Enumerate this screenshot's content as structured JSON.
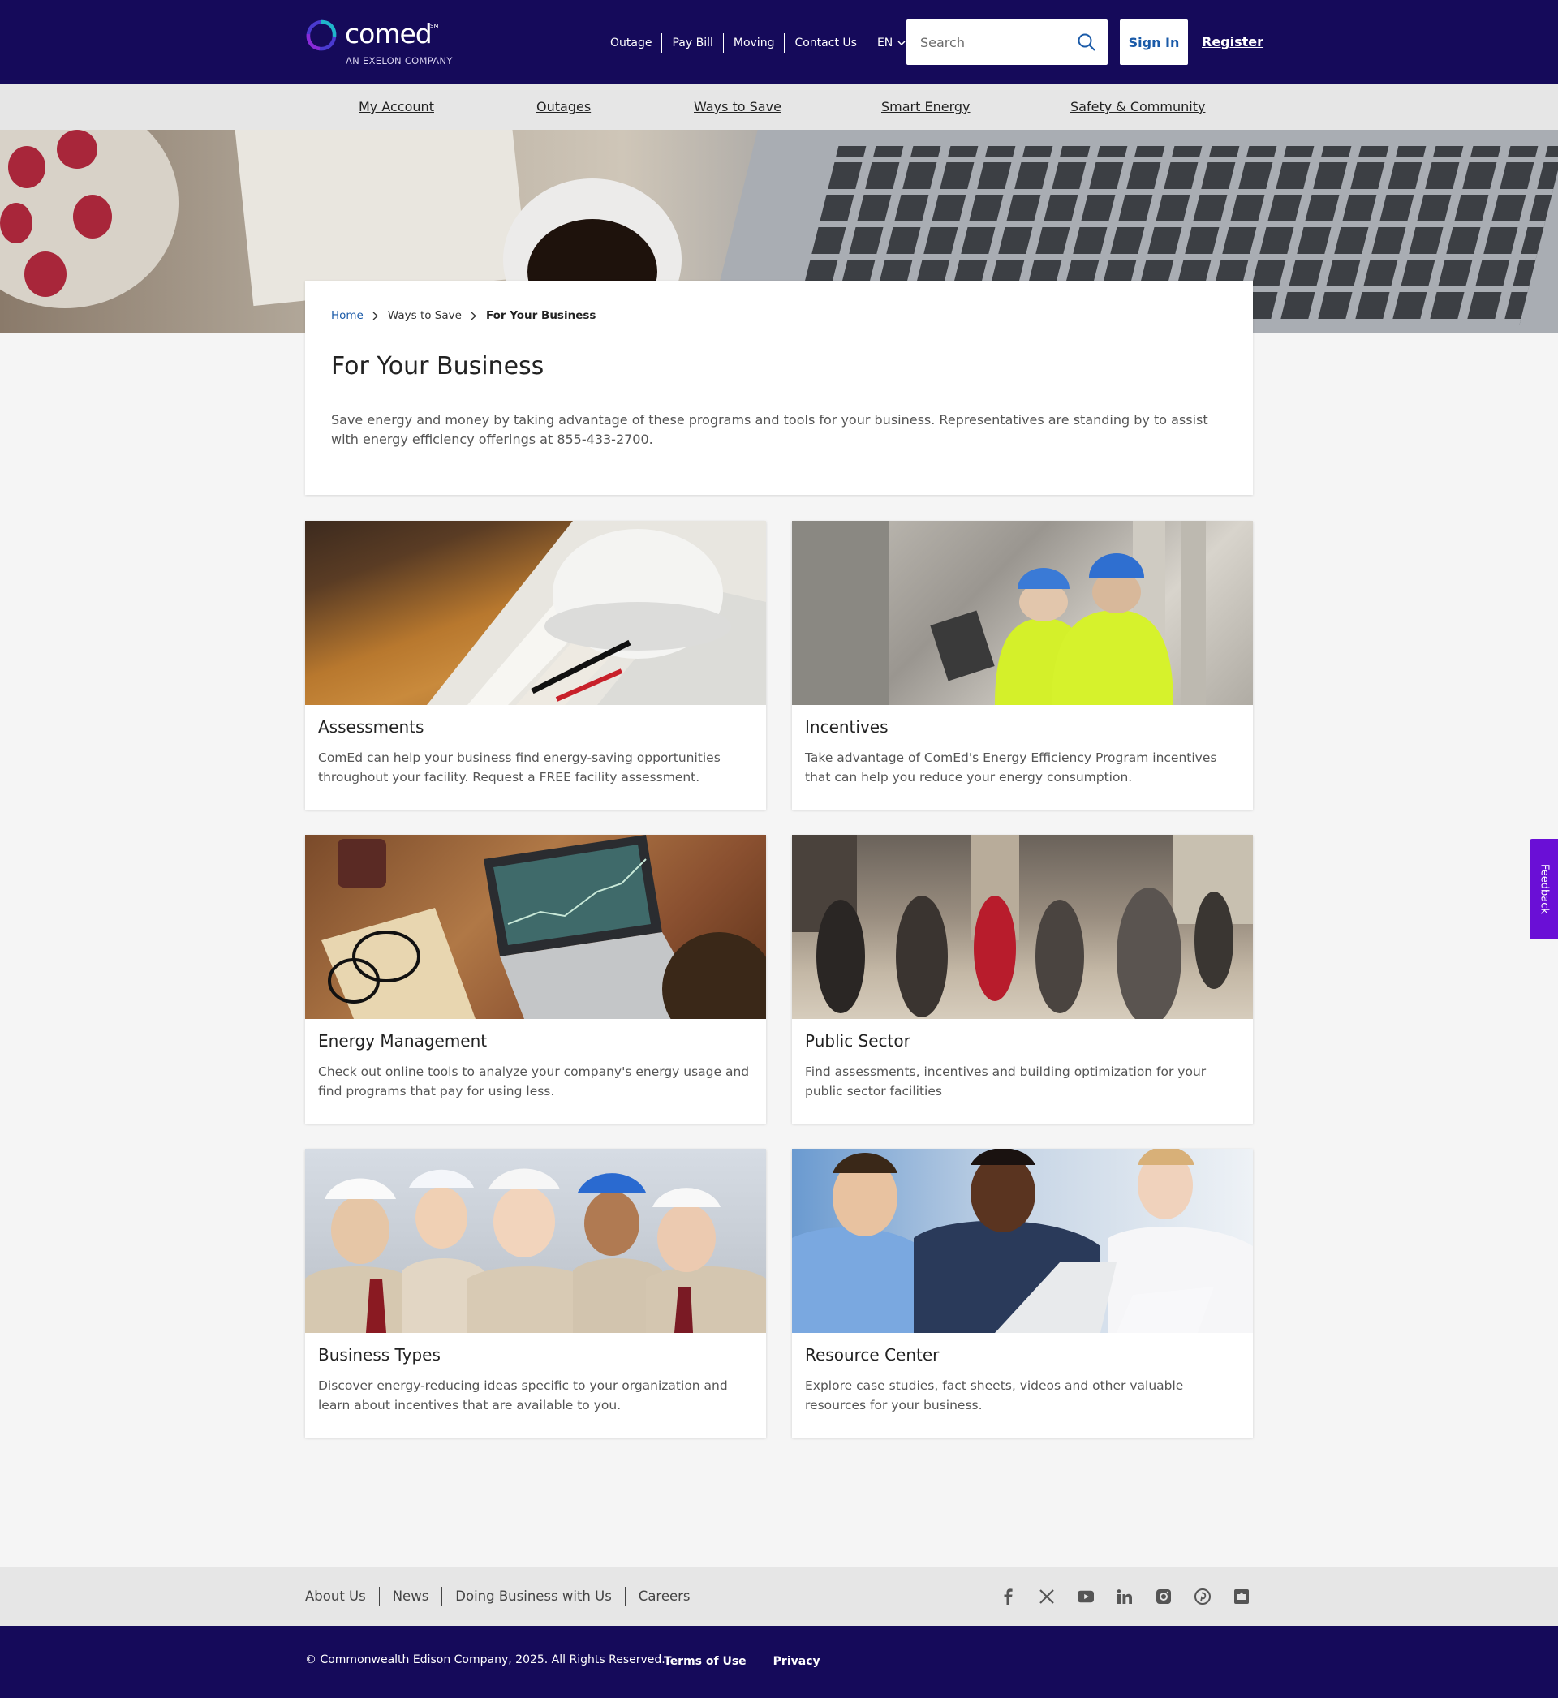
{
  "brand": {
    "name": "comed",
    "mark": "SM",
    "tagline": "AN EXELON COMPANY"
  },
  "utility_nav": {
    "links": [
      "Outage",
      "Pay Bill",
      "Moving",
      "Contact Us"
    ],
    "language": "EN"
  },
  "search": {
    "placeholder": "Search"
  },
  "auth": {
    "sign_in": "Sign In",
    "register": "Register"
  },
  "main_nav": [
    "My Account",
    "Outages",
    "Ways to Save",
    "Smart Energy",
    "Safety & Community"
  ],
  "breadcrumb": [
    "Home",
    "Ways to Save",
    "For Your Business"
  ],
  "page": {
    "title": "For Your Business",
    "intro": "Save energy and money by taking advantage of these programs and tools for your business. Representatives are standing by to assist with energy efficiency offerings at 855-433-2700."
  },
  "tiles": [
    {
      "title": "Assessments",
      "desc": "ComEd can help your business find energy-saving opportunities throughout your facility. Request a FREE facility assessment."
    },
    {
      "title": "Incentives",
      "desc": "Take advantage of ComEd's Energy Efficiency Program incentives that can help you reduce your energy consumption."
    },
    {
      "title": "Energy Management",
      "desc": "Check out online tools to analyze your company's energy usage and find programs that pay for using less."
    },
    {
      "title": "Public Sector",
      "desc": "Find assessments, incentives and building optimization for your public sector facilities"
    },
    {
      "title": "Business Types",
      "desc": "Discover energy-reducing ideas specific to your organization and learn about incentives that are available to you."
    },
    {
      "title": "Resource Center",
      "desc": "Explore case studies, fact sheets, videos and other valuable resources for your business."
    }
  ],
  "feedback": "Feedback",
  "footer": {
    "links": [
      "About Us",
      "News",
      "Doing Business with Us",
      "Careers"
    ],
    "social": [
      "facebook-icon",
      "x-icon",
      "youtube-icon",
      "linkedin-icon",
      "instagram-icon",
      "pinterest-icon",
      "flickr-icon"
    ],
    "copyright": "© Commonwealth Edison Company, 2025. All Rights Reserved.",
    "legal": [
      "Terms of Use",
      "Privacy"
    ]
  },
  "colors": {
    "header_bg": "#150a5a",
    "nav_bg": "#e6e6e6",
    "link_blue": "#1a5aa8",
    "feedback_purple": "#6a0fd6"
  }
}
